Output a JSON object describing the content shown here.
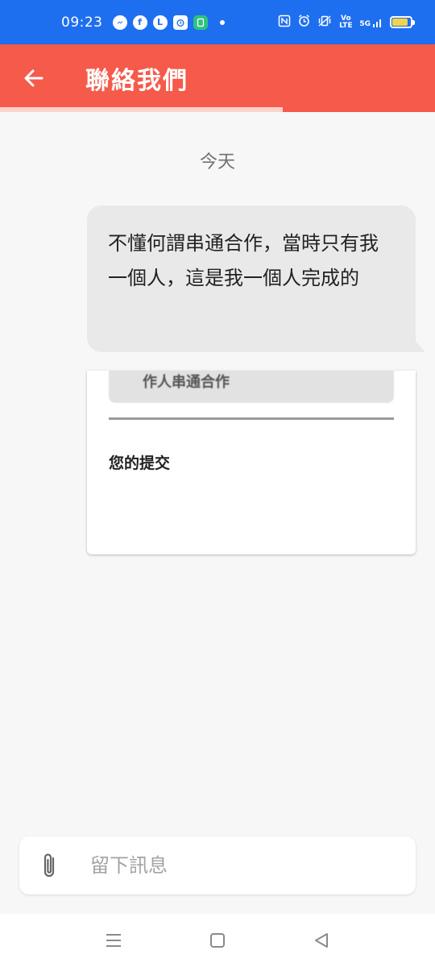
{
  "status_bar": {
    "time": "09:23",
    "left_icons": [
      "messenger-icon",
      "facebook-icon",
      "line-icon",
      "alarm-app-icon",
      "green-app-icon"
    ],
    "right_icons": [
      "nfc-icon",
      "alarm-icon",
      "vibrate-icon",
      "volte-icon",
      "signal-5g-icon",
      "battery-icon"
    ],
    "volte_label": "Vo LTE",
    "net_label": "5G",
    "battery_level": 0.85,
    "colors": {
      "background": "#1e6ff0",
      "battery_fill": "#f2d34f"
    }
  },
  "app_bar": {
    "title": "聯絡我們",
    "progress": 0.65,
    "colors": {
      "background": "#f55a4b",
      "progress": "#ffd2c8"
    }
  },
  "chat": {
    "date_label": "今天",
    "messages": [
      {
        "text": "不懂何謂串通合作，當時只有我一個人，這是我一個人完成的"
      }
    ],
    "attachment_preview": {
      "top_box_text": "作人串通合作",
      "label": "您的提交"
    }
  },
  "input": {
    "placeholder": "留下訊息",
    "value": ""
  },
  "nav_bar": {
    "buttons": [
      "menu-icon",
      "home-icon",
      "back-triangle-icon"
    ]
  }
}
